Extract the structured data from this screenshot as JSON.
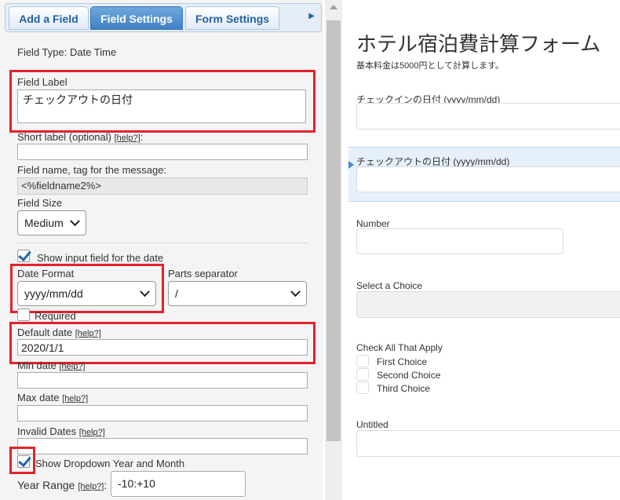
{
  "tabs": [
    {
      "label": "Add a Field"
    },
    {
      "label": "Field Settings"
    },
    {
      "label": "Form Settings"
    }
  ],
  "tab_more_icon": "triangle-right-icon",
  "settings": {
    "field_type": "Field Type: Date Time",
    "field_label": {
      "label": "Field Label",
      "value": "チェックアウトの日付"
    },
    "short_label": {
      "label": "Short label (optional)",
      "help": "[help?]",
      "suffix": ":",
      "value": ""
    },
    "field_name": {
      "label": "Field name, tag for the message:",
      "value": "<%fieldname2%>"
    },
    "field_size": {
      "label": "Field Size",
      "value": "Medium"
    },
    "show_input": {
      "label": "Show input field for the date",
      "checked": true
    },
    "date_format": {
      "label": "Date Format",
      "value": "yyyy/mm/dd"
    },
    "parts_separator": {
      "label": "Parts separator",
      "value": "/"
    },
    "required": {
      "label": "Required",
      "checked": false
    },
    "default_date": {
      "label": "Default date",
      "help": "[help?]",
      "value": "2020/1/1"
    },
    "min_date": {
      "label": "Min date",
      "help": "[help?]",
      "value": ""
    },
    "max_date": {
      "label": "Max date",
      "help": "[help?]",
      "value": ""
    },
    "invalid_dates": {
      "label": "Invalid Dates",
      "help": "[help?]",
      "value": ""
    },
    "show_dropdown": {
      "label": "Show Dropdown Year and Month",
      "checked": true
    },
    "year_range": {
      "label": "Year Range",
      "help": "[help?]",
      "suffix": ":",
      "value": "-10:+10"
    }
  },
  "form": {
    "title": "ホテル宿泊費計算フォーム",
    "description": "基本料金は5000円として計算します。",
    "fields": {
      "checkin": {
        "label": "チェックインの日付 (yyyy/mm/dd)"
      },
      "checkout": {
        "label": "チェックアウトの日付 (yyyy/mm/dd)"
      },
      "number": {
        "label": "Number"
      },
      "select": {
        "label": "Select a Choice"
      },
      "checkall": {
        "label": "Check All That Apply",
        "choices": [
          "First Choice",
          "Second Choice",
          "Third Choice"
        ]
      },
      "untitled": {
        "label": "Untitled"
      }
    }
  },
  "colors": {
    "accent": "#3f80c3",
    "highlight": "#e2222c",
    "selected_bg": "#e6f0fb"
  }
}
